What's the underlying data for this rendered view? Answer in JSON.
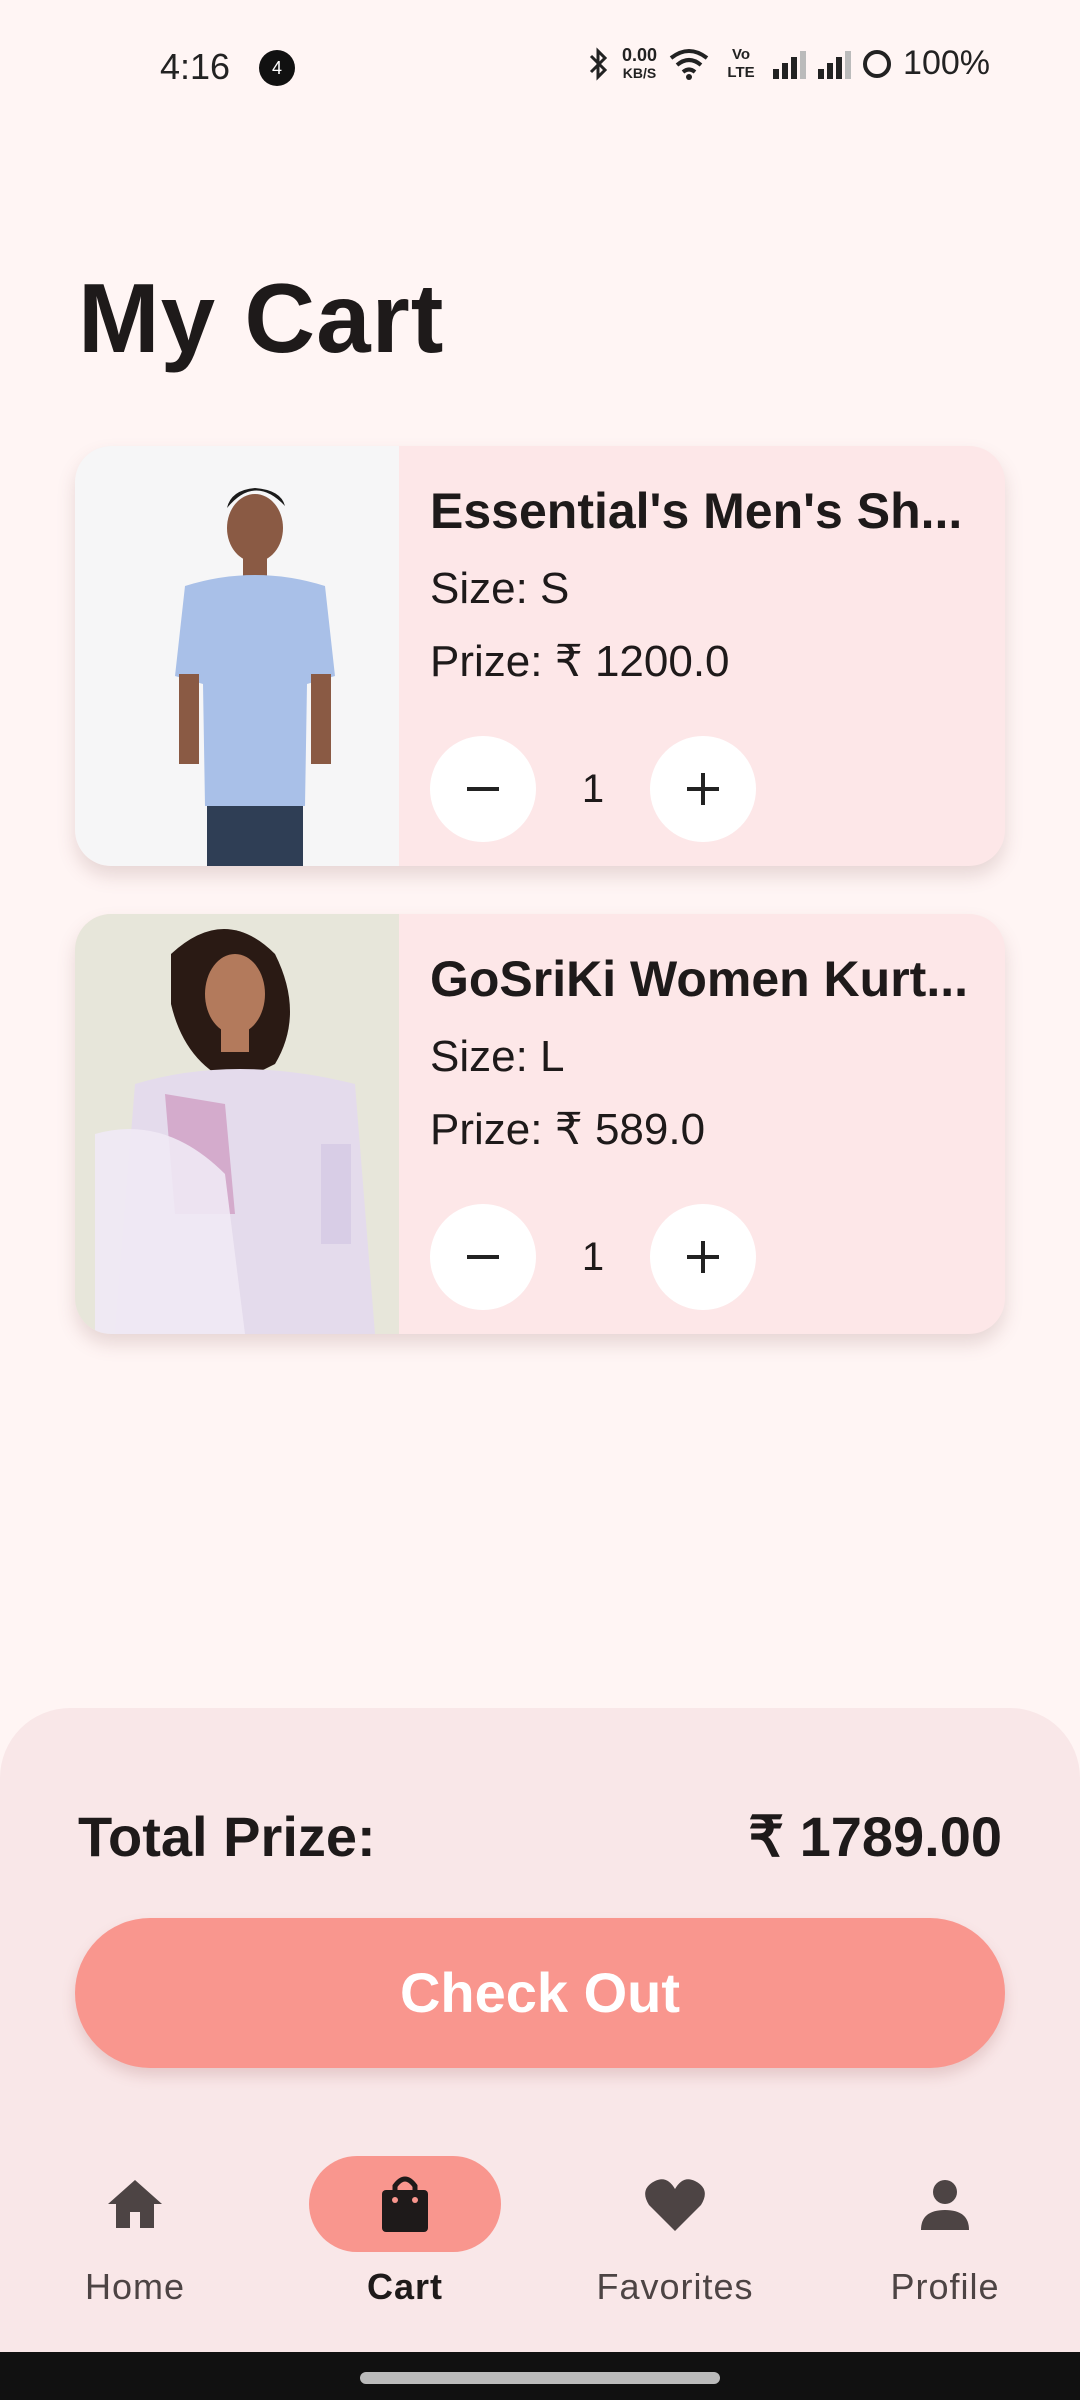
{
  "status_bar": {
    "time": "4:16",
    "notification_count": "4",
    "net_speed_value": "0.00",
    "net_speed_unit": "KB/S",
    "volte": "Vo LTE",
    "battery": "100%"
  },
  "page": {
    "title": "My Cart"
  },
  "cart": {
    "items": [
      {
        "name": "Essential's Men's Sh...",
        "size": "Size: S",
        "prize_label": "Prize:",
        "currency": "₹",
        "prize": "1200.0",
        "quantity": "1"
      },
      {
        "name": "GoSriKi Women Kurt...",
        "size": "Size: L",
        "prize_label": "Prize:",
        "currency": "₹",
        "prize": "589.0",
        "quantity": "1"
      }
    ]
  },
  "summary": {
    "total_label": "Total Prize:",
    "currency": "₹",
    "total_value": "1789.00",
    "checkout_label": "Check Out"
  },
  "nav": {
    "items": [
      {
        "label": "Home",
        "icon": "home-icon"
      },
      {
        "label": "Cart",
        "icon": "shopping-bag-icon",
        "active": true
      },
      {
        "label": "Favorites",
        "icon": "heart-icon"
      },
      {
        "label": "Profile",
        "icon": "person-icon"
      }
    ]
  },
  "colors": {
    "accent": "#f9968e",
    "card": "#fde7e8",
    "background": "#fff5f4"
  }
}
